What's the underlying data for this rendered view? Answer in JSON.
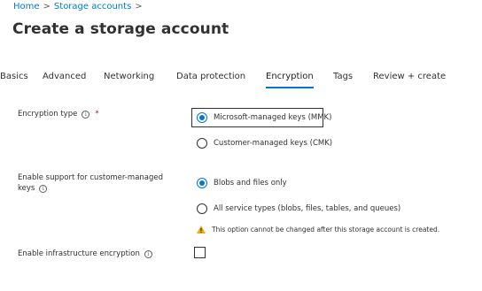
{
  "breadcrumb": {
    "home": "Home",
    "separator": ">",
    "storage_accounts": "Storage accounts",
    "trailing_separator": ">"
  },
  "page": {
    "title": "Create a storage account",
    "more_label": "···"
  },
  "tabs": [
    {
      "label": "Basics",
      "active": false
    },
    {
      "label": "Advanced",
      "active": false
    },
    {
      "label": "Networking",
      "active": false
    },
    {
      "label": "Data protection",
      "active": false
    },
    {
      "label": "Encryption",
      "active": true
    },
    {
      "label": "Tags",
      "active": false
    },
    {
      "label": "Review + create",
      "active": false
    }
  ],
  "encryption_type": {
    "label": "Encryption type",
    "required_marker": "*",
    "info_icon": "info-icon",
    "options": [
      {
        "label": "Microsoft-managed keys (MMK)",
        "selected": true
      },
      {
        "label": "Customer-managed keys (CMK)",
        "selected": false
      }
    ]
  },
  "customer_managed_keys_support": {
    "label_line1": "Enable support for customer-managed",
    "label_line2": "keys",
    "info_icon": "info-icon",
    "options": [
      {
        "label": "Blobs and files only",
        "selected": true
      },
      {
        "label": "All service types (blobs, files, tables, and queues)",
        "selected": false
      }
    ],
    "warning_icon": "warning-icon",
    "warning_text": "This option cannot be changed after this storage account is created."
  },
  "infrastructure_encryption": {
    "label": "Enable infrastructure encryption",
    "info_icon": "info-icon",
    "checked": false
  },
  "colors": {
    "accent": "#0078d4",
    "text": "#323130",
    "required": "#a4262c",
    "warning": "#f2a900"
  }
}
